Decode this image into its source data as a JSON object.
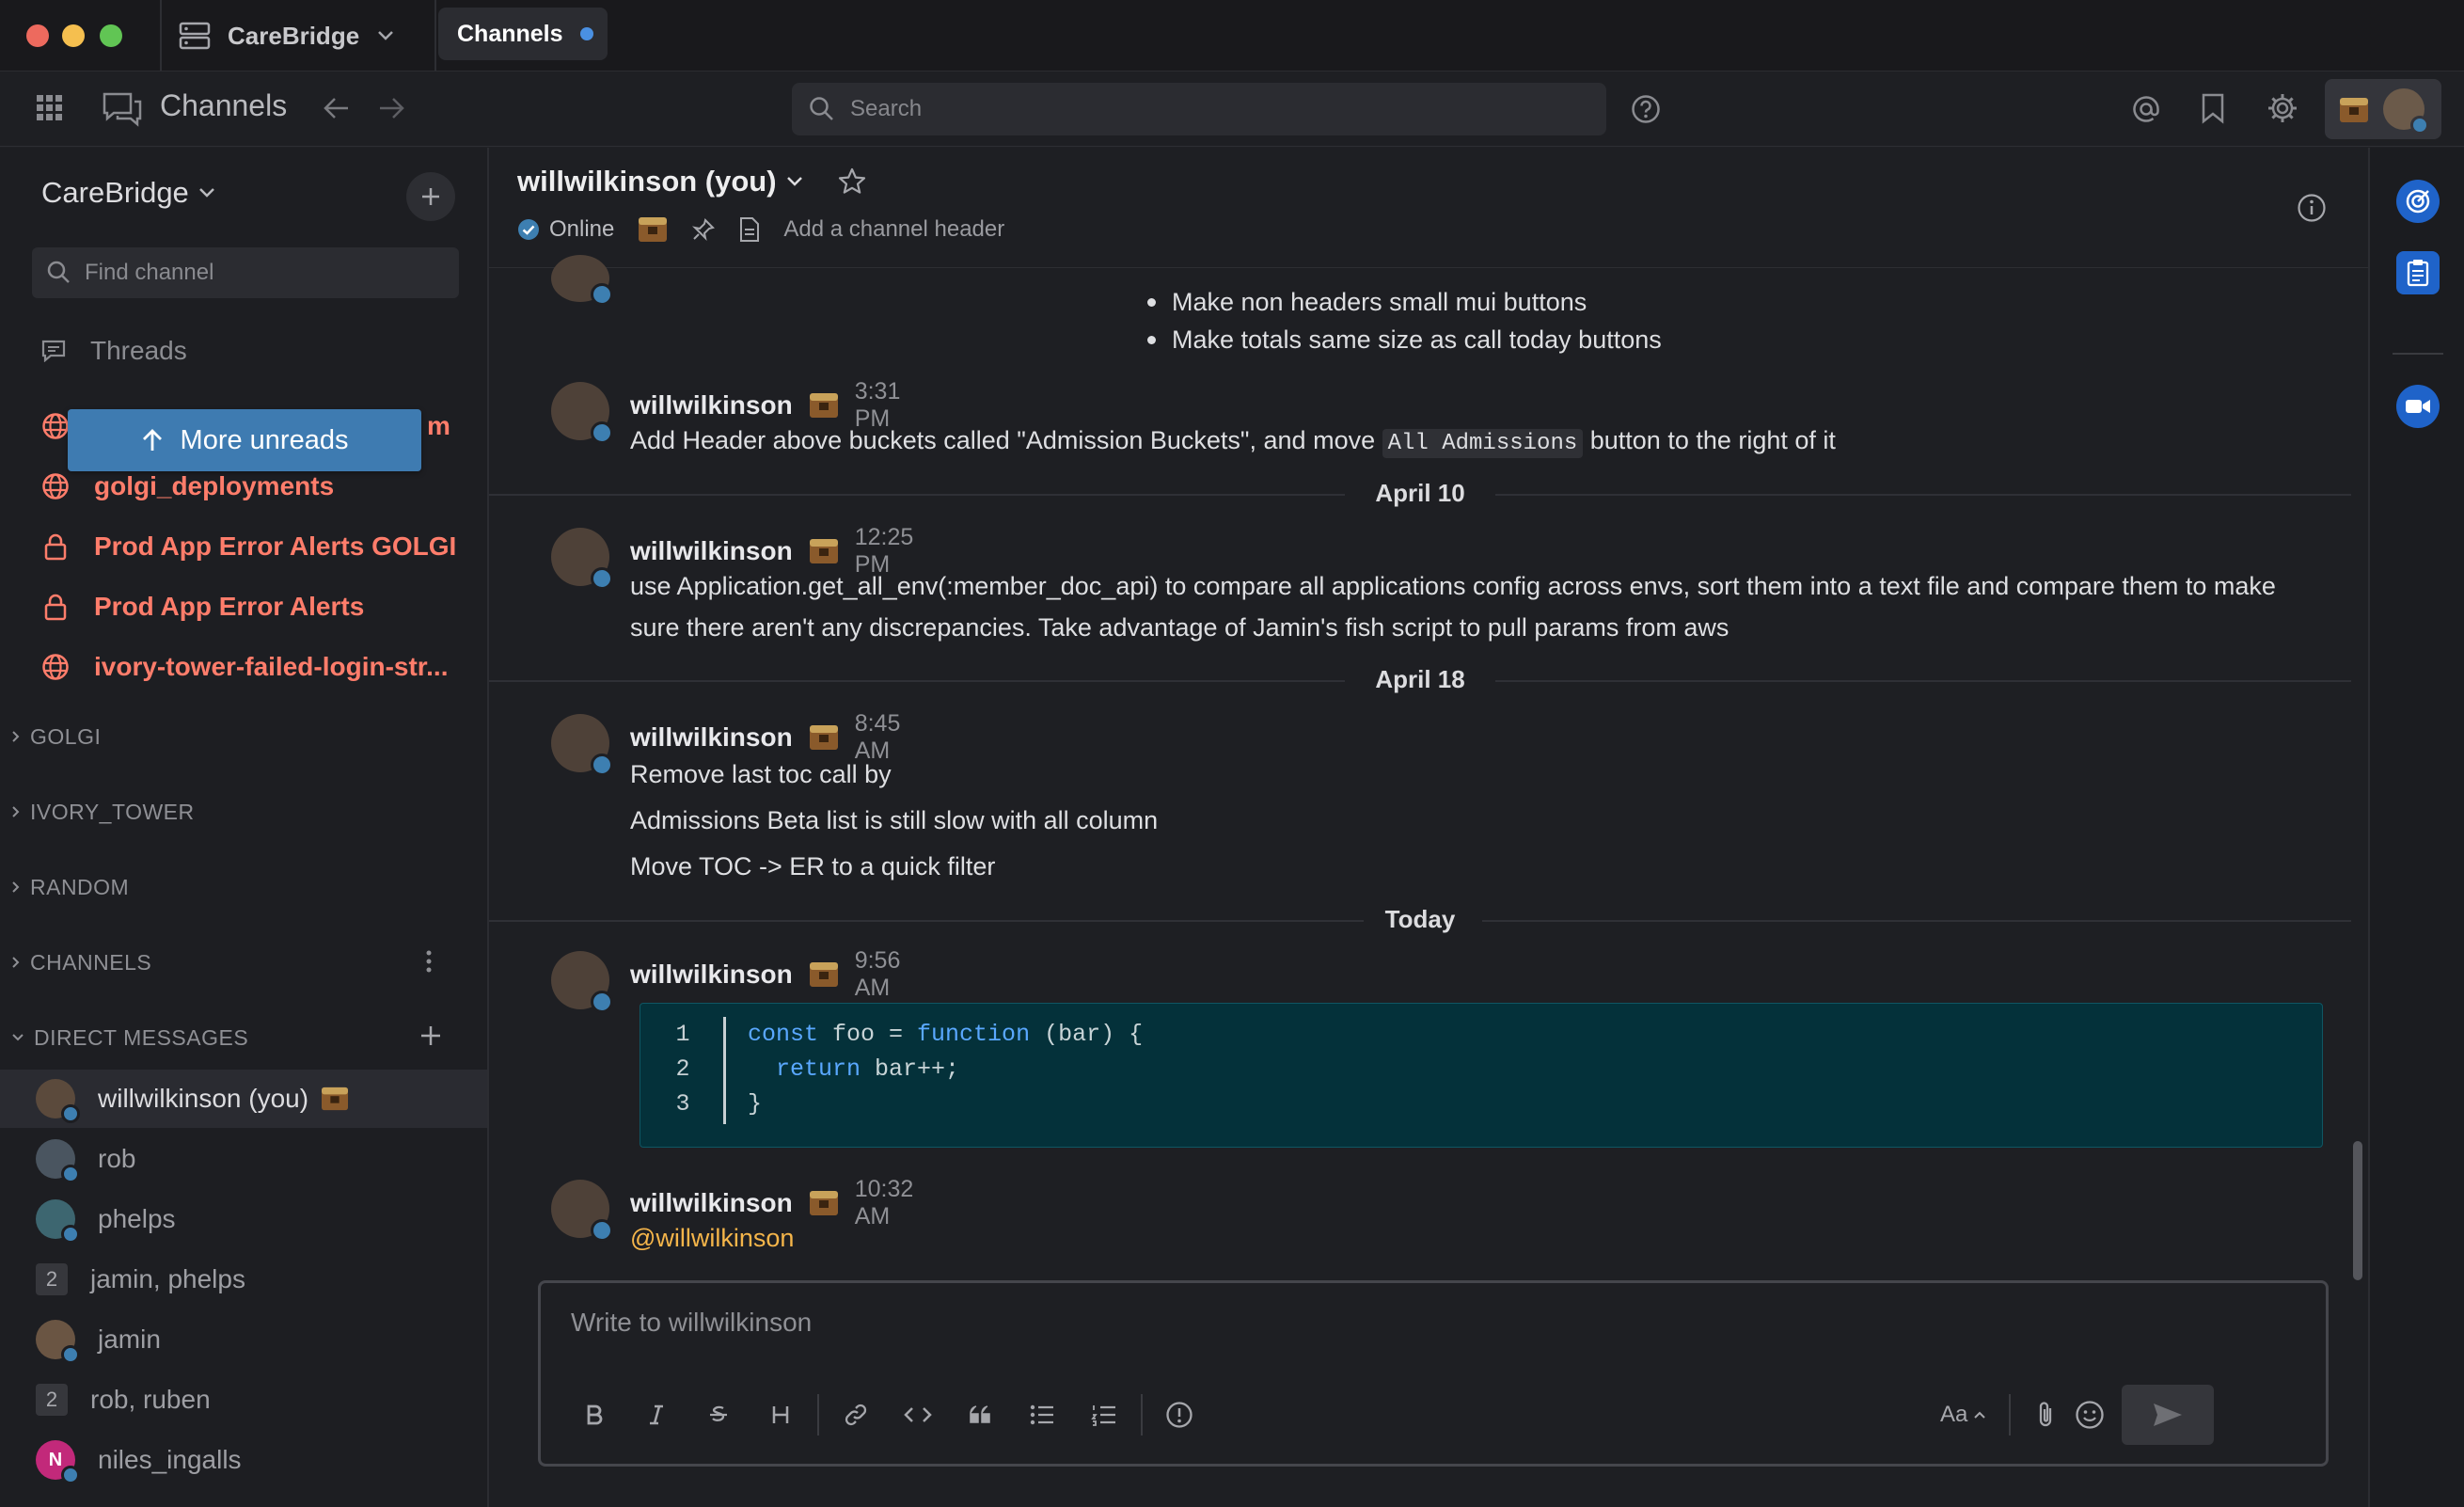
{
  "titlebar": {
    "server_name": "CareBridge",
    "tab_label": "Channels"
  },
  "globalbar": {
    "title": "Channels",
    "search_placeholder": "Search"
  },
  "sidebar": {
    "team_name": "CareBridge",
    "find_channel_placeholder": "Find channel",
    "threads_label": "Threads",
    "more_unreads_label": "More unreads",
    "hidden_channel_tail": "m",
    "channels": [
      {
        "name": "golgi_deployments",
        "icon": "globe-icon"
      },
      {
        "name": "Prod App Error Alerts GOLGI",
        "icon": "lock-icon"
      },
      {
        "name": "Prod App Error Alerts",
        "icon": "lock-icon"
      },
      {
        "name": "ivory-tower-failed-login-str...",
        "icon": "globe-icon"
      }
    ],
    "categories": [
      "GOLGI",
      "IVORY_TOWER",
      "RANDOM",
      "CHANNELS",
      "DIRECT MESSAGES"
    ],
    "direct_messages": [
      {
        "name": "willwilkinson (you)",
        "active": true
      },
      {
        "name": "rob"
      },
      {
        "name": "phelps"
      },
      {
        "name": "jamin, phelps",
        "count": "2"
      },
      {
        "name": "jamin"
      },
      {
        "name": "rob, ruben",
        "count": "2"
      },
      {
        "name": "niles_ingalls",
        "initial": "N"
      }
    ]
  },
  "channel": {
    "name": "willwilkinson (you)",
    "status": "Online",
    "header_placeholder": "Add a channel header"
  },
  "messages": {
    "partial": {
      "bullets": [
        "Make non headers small mui buttons",
        "Make totals same size as call today buttons"
      ]
    },
    "m1": {
      "author": "willwilkinson",
      "time": "3:31 PM",
      "text_before": "Add Header above buckets called \"Admission Buckets\", and move ",
      "code": "All Admissions",
      "text_after": " button to the right of it"
    },
    "date1": "April 10",
    "m2": {
      "author": "willwilkinson",
      "time": "12:25 PM",
      "text": "use Application.get_all_env(:member_doc_api) to compare all applications config across envs, sort them into a text file and compare them to make sure there aren't any discrepancies. Take advantage of Jamin's fish script to pull params from aws"
    },
    "date2": "April 18",
    "m3": {
      "author": "willwilkinson",
      "time": "8:45 AM",
      "lines": [
        "Remove last toc call by",
        "Admissions Beta list is still slow with all column",
        "Move TOC -> ER to a quick filter"
      ]
    },
    "date3": "Today",
    "m4": {
      "author": "willwilkinson",
      "time": "9:56 AM",
      "code_line_numbers": [
        "1",
        "2",
        "3"
      ],
      "code_lines": [
        "const foo = function (bar) {",
        "  return bar++;",
        "}"
      ]
    },
    "m5": {
      "author": "willwilkinson",
      "time": "10:32 AM",
      "mention": "@willwilkinson"
    }
  },
  "composer": {
    "placeholder": "Write to willwilkinson",
    "format_label": "Aa"
  },
  "colors": {
    "unread": "#ff7d6b",
    "accent": "#3e7bb1",
    "code_bg": "#04313a",
    "mention": "#f5b54a"
  }
}
